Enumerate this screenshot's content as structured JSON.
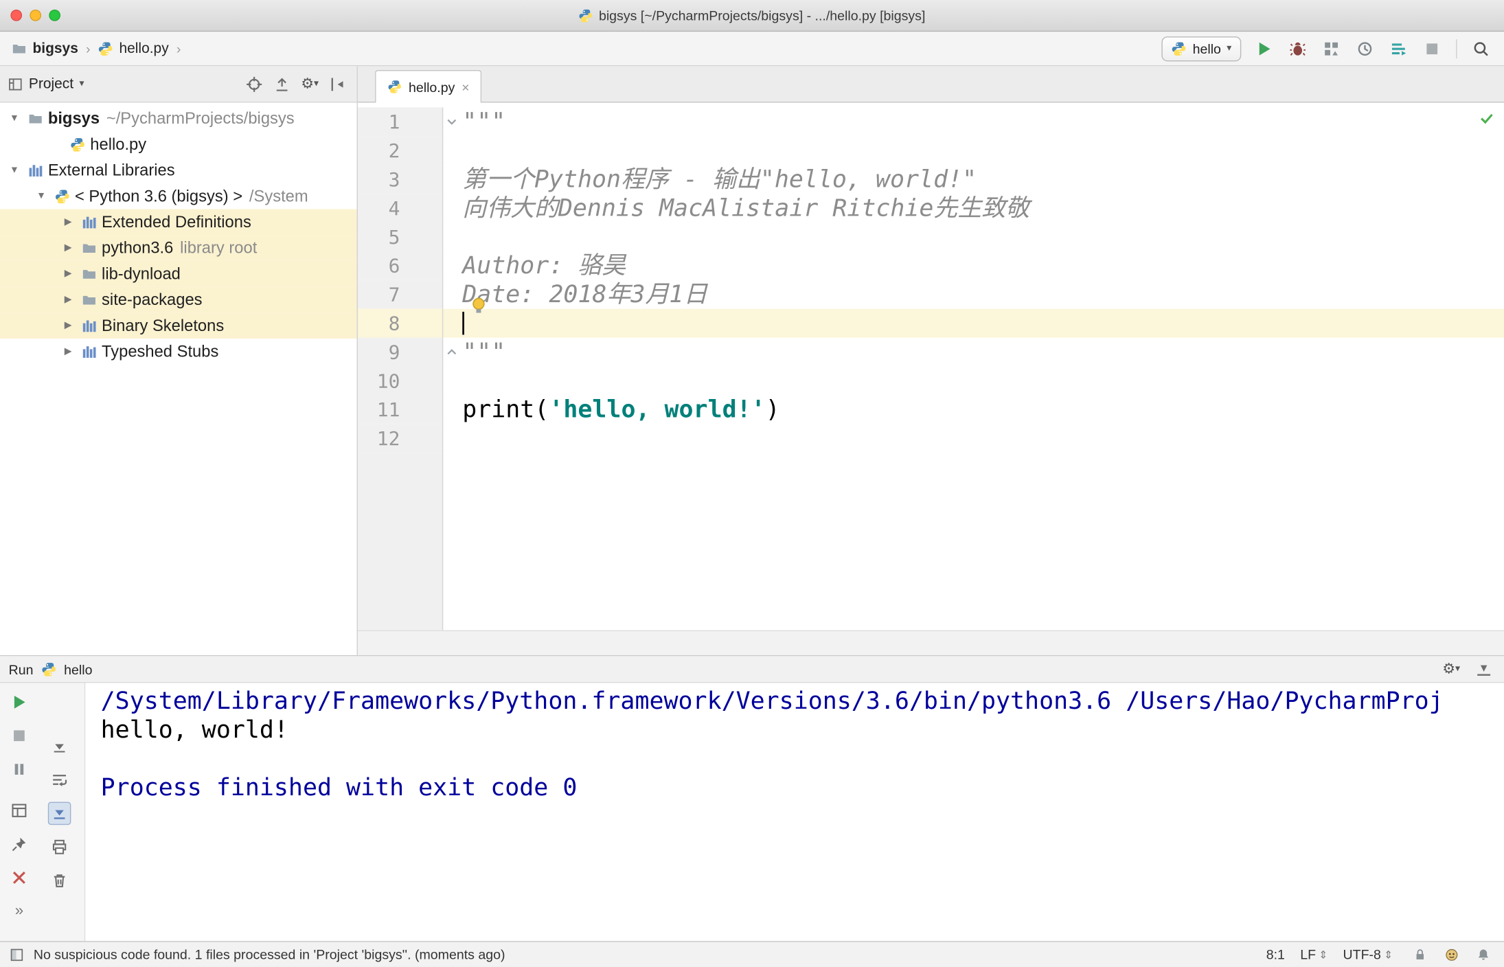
{
  "window": {
    "title": "bigsys [~/PycharmProjects/bigsys] - .../hello.py [bigsys]"
  },
  "navbar": {
    "breadcrumbs": [
      {
        "label": "bigsys"
      },
      {
        "label": "hello.py"
      }
    ],
    "separator": "›",
    "run_config": {
      "label": "hello"
    },
    "actions": [
      "run",
      "debug",
      "coverage",
      "profile",
      "concurrency",
      "stop",
      "search"
    ]
  },
  "project_panel": {
    "title": "Project",
    "header_actions": [
      "locate",
      "collapse-all",
      "settings",
      "hide"
    ],
    "tree": [
      {
        "label": "bigsys",
        "extra": "~/PycharmProjects/bigsys",
        "icon": "folder",
        "expand": "open",
        "bold": true,
        "indent": 6
      },
      {
        "label": "hello.py",
        "icon": "python",
        "indent": 50
      },
      {
        "label": "External Libraries",
        "icon": "library",
        "expand": "open",
        "indent": 6
      },
      {
        "label": "< Python 3.6 (bigsys) >",
        "extra": "/System",
        "icon": "python",
        "expand": "open",
        "indent": 34
      },
      {
        "label": "Extended Definitions",
        "icon": "library",
        "expand": "closed",
        "highlight": true,
        "indent": 62
      },
      {
        "label": "python3.6",
        "extra": "library root",
        "icon": "folder",
        "expand": "closed",
        "highlight": true,
        "indent": 62
      },
      {
        "label": "lib-dynload",
        "icon": "folder",
        "expand": "closed",
        "highlight": true,
        "indent": 62
      },
      {
        "label": "site-packages",
        "icon": "folder",
        "expand": "closed",
        "highlight": true,
        "indent": 62
      },
      {
        "label": "Binary Skeletons",
        "icon": "library",
        "expand": "closed",
        "highlight": true,
        "indent": 62
      },
      {
        "label": "Typeshed Stubs",
        "icon": "library",
        "expand": "closed",
        "indent": 62
      }
    ]
  },
  "editor": {
    "tab": {
      "label": "hello.py"
    },
    "lines": [
      {
        "num": "1",
        "fold": "start",
        "tokens": [
          {
            "t": "\"\"\"",
            "c": "doc"
          }
        ]
      },
      {
        "num": "2",
        "tokens": []
      },
      {
        "num": "3",
        "tokens": [
          {
            "t": "第一个Python程序 - 输出\"hello, world!\"",
            "c": "doc"
          }
        ]
      },
      {
        "num": "4",
        "tokens": [
          {
            "t": "向伟大的Dennis MacAlistair Ritchie先生致敬",
            "c": "doc"
          }
        ]
      },
      {
        "num": "5",
        "tokens": []
      },
      {
        "num": "6",
        "tokens": [
          {
            "t": "Author: 骆昊",
            "c": "doc"
          }
        ]
      },
      {
        "num": "7",
        "tokens": [
          {
            "t": "Date: 2018年3月1日",
            "c": "doc"
          }
        ],
        "bulb": true
      },
      {
        "num": "8",
        "tokens": [],
        "highlight": true,
        "caret": true
      },
      {
        "num": "9",
        "fold": "end",
        "tokens": [
          {
            "t": "\"\"\"",
            "c": "doc"
          }
        ]
      },
      {
        "num": "10",
        "tokens": []
      },
      {
        "num": "11",
        "tokens": [
          {
            "t": "print(",
            "c": "plain"
          },
          {
            "t": "'hello, world!'",
            "c": "string"
          },
          {
            "t": ")",
            "c": "plain"
          }
        ]
      },
      {
        "num": "12",
        "tokens": []
      }
    ]
  },
  "run_panel": {
    "title": "Run",
    "process": {
      "label": "hello"
    },
    "header_actions": [
      "settings",
      "hide-bottom"
    ],
    "toolbar_main": [
      "rerun",
      "stop",
      "pause",
      "restore-layout",
      "pin",
      "close",
      "more"
    ],
    "toolbar_console": [
      "down-stack",
      "soft-wrap",
      "scroll-end",
      "print",
      "clear"
    ],
    "console": [
      {
        "text": "/System/Library/Frameworks/Python.framework/Versions/3.6/bin/python3.6 /Users/Hao/PycharmProj",
        "c": "sys"
      },
      {
        "text": "hello, world!",
        "c": "out"
      },
      {
        "text": "",
        "c": "out"
      },
      {
        "text": "Process finished with exit code 0",
        "c": "sys"
      }
    ]
  },
  "status_bar": {
    "message": "No suspicious code found. 1 files processed in 'Project 'bigsys''. (moments ago)",
    "position": "8:1",
    "line_ending": "LF",
    "encoding": "UTF-8",
    "icons": [
      "lock",
      "hector",
      "bell"
    ]
  },
  "colors": {
    "accent_run": "#3fa45b",
    "string": "#00807a",
    "doc": "#8c8c8c",
    "console_system": "#00009b",
    "line_highlight": "#fcf6da",
    "tree_highlight": "#fbf2d0",
    "error_close": "#c75450"
  }
}
